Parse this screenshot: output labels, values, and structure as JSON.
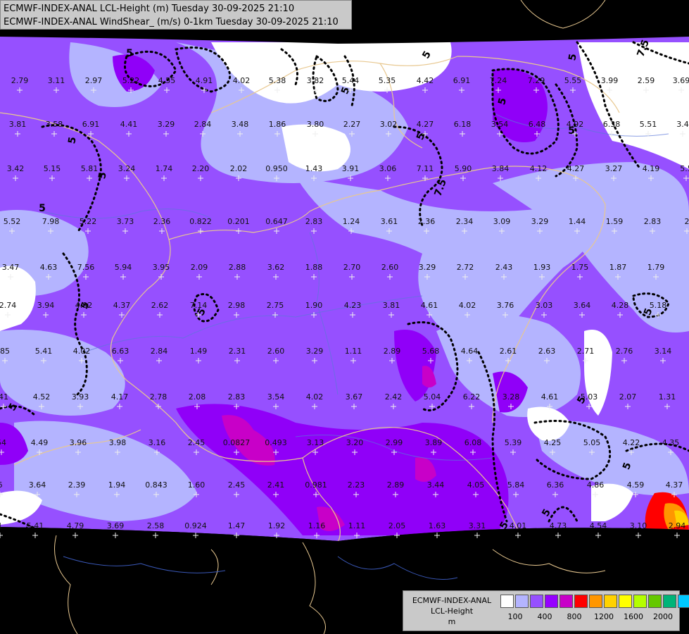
{
  "header": {
    "line1": "ECMWF-INDEX-ANAL LCL-Height (m) Tuesday 30-09-2025 21:10",
    "line2": "ECMWF-INDEX-ANAL WindShear_ (m/s) 0-1km Tuesday 30-09-2025 21:10"
  },
  "legend": {
    "line1": "ECMWF-INDEX-ANAL",
    "line2": "LCL-Height",
    "line3": "m",
    "colors": [
      "#ffffff",
      "#b4b4ff",
      "#9650ff",
      "#9600ff",
      "#c800c8",
      "#ff0000",
      "#ff9600",
      "#ffd200",
      "#ffff00",
      "#b4ff00",
      "#64c800",
      "#00b478",
      "#00c8ff"
    ],
    "ticks": [
      "100",
      "400",
      "800",
      "1200",
      "1600",
      "2000"
    ]
  },
  "contour_labels": [
    "5",
    "5",
    "5",
    "5",
    "5",
    "7.5",
    "5",
    "5",
    "7.5",
    "5",
    "5",
    "5",
    "5",
    "5",
    "5",
    "5",
    "5",
    "5",
    "5",
    "5",
    "5"
  ],
  "windshear_values": [
    "2.79",
    "3.11",
    "2.97",
    "5.22",
    "4.55",
    "4.91",
    "4.02",
    "5.38",
    "3.82",
    "5.44",
    "5.35",
    "4.42",
    "6.91",
    "7.24",
    "7.29",
    "5.55",
    "3.99",
    "2.59",
    "3.69",
    "3.81",
    "3.58",
    "6.91",
    "4.41",
    "3.29",
    "2.84",
    "3.48",
    "1.86",
    "3.80",
    "2.27",
    "3.02",
    "4.27",
    "6.18",
    "3.54",
    "6.48",
    "4.92",
    "6.38",
    "5.51",
    "3.4",
    "3.42",
    "5.15",
    "5.81",
    "3.24",
    "1.74",
    "2.20",
    "2.02",
    "0.950",
    "1.43",
    "3.91",
    "3.06",
    "7.11",
    "5.90",
    "3.84",
    "4.12",
    "4.27",
    "3.27",
    "4.19",
    "5.5",
    "5.52",
    "7.98",
    "5.22",
    "3.73",
    "2.36",
    "0.822",
    "0.201",
    "0.647",
    "2.83",
    "1.24",
    "3.61",
    "2.36",
    "2.34",
    "3.09",
    "3.29",
    "1.44",
    "1.59",
    "2.83",
    "2",
    "3.47",
    "4.63",
    "7.56",
    "5.94",
    "3.95",
    "2.09",
    "2.88",
    "3.62",
    "1.88",
    "2.70",
    "2.60",
    "3.29",
    "2.72",
    "2.43",
    "1.93",
    "1.75",
    "1.87",
    "1.79",
    "2.74",
    "3.94",
    "4.92",
    "4.37",
    "2.62",
    "7.14",
    "2.98",
    "2.75",
    "1.90",
    "4.23",
    "3.81",
    "4.61",
    "4.02",
    "3.76",
    "3.03",
    "3.64",
    "4.28",
    "5.18",
    "85",
    "5.41",
    "4.02",
    "6.63",
    "2.84",
    "1.49",
    "2.31",
    "2.60",
    "3.29",
    "1.11",
    "2.89",
    "5.68",
    "4.64",
    "2.61",
    "2.63",
    "2.71",
    "2.76",
    "3.14",
    "41",
    "4.52",
    "3.93",
    "4.17",
    "2.78",
    "2.08",
    "2.83",
    "3.54",
    "4.02",
    "3.67",
    "2.42",
    "5.04",
    "6.22",
    "3.28",
    "4.61",
    "5.03",
    "2.07",
    "1.31",
    "54",
    "4.49",
    "3.96",
    "3.98",
    "3.16",
    "2.45",
    "0.0827",
    "0.493",
    "3.13",
    "3.20",
    "2.99",
    "3.89",
    "6.08",
    "5.39",
    "4.25",
    "5.05",
    "4.22",
    "4.35",
    "6",
    "3.64",
    "2.39",
    "1.94",
    "0.843",
    "1.60",
    "2.45",
    "2.41",
    "0.981",
    "2.23",
    "2.89",
    "3.44",
    "4.05",
    "5.84",
    "6.36",
    "4.86",
    "4.59",
    "4.37",
    "1",
    "5.41",
    "4.79",
    "3.69",
    "2.58",
    "0.924",
    "1.47",
    "1.92",
    "1.16",
    "1.11",
    "2.05",
    "1.63",
    "3.31",
    "4.01",
    "4.73",
    "4.54",
    "3.10",
    "2.94"
  ]
}
